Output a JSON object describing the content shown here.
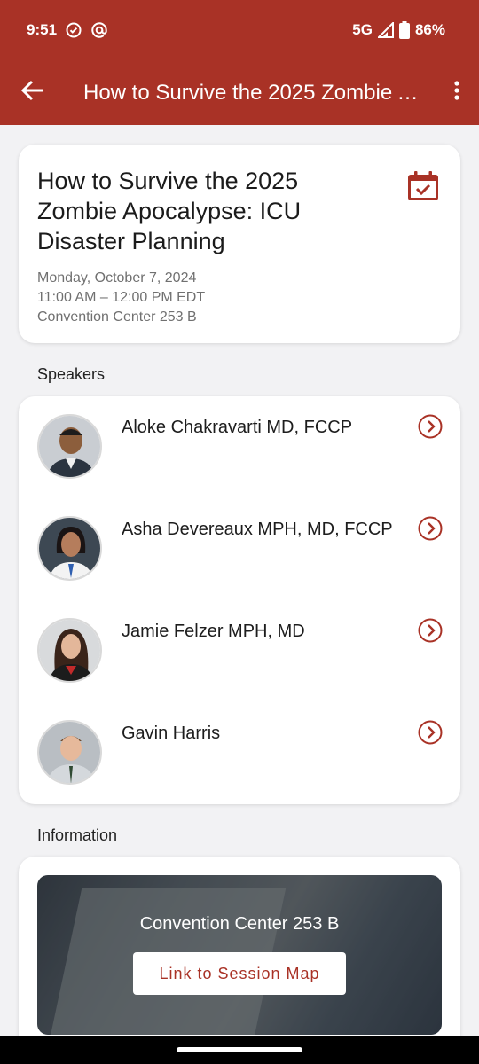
{
  "status_bar": {
    "time": "9:51",
    "network": "5G",
    "battery": "86%"
  },
  "toolbar": {
    "title": "How to Survive the 2025 Zombie Apocalypse: ICU Disaster Planning"
  },
  "session": {
    "title": "How to Survive the 2025 Zombie Apocalypse: ICU Disaster Planning",
    "date": "Monday, October 7, 2024",
    "time": "11:00 AM – 12:00 PM EDT",
    "location": "Convention Center 253 B"
  },
  "speakers_label": "Speakers",
  "speakers": [
    {
      "name": "Aloke Chakravarti MD, FCCP"
    },
    {
      "name": "Asha Devereaux MPH, MD, FCCP"
    },
    {
      "name": "Jamie Felzer MPH, MD"
    },
    {
      "name": "Gavin Harris"
    }
  ],
  "information_label": "Information",
  "information": {
    "location": "Convention Center 253 B",
    "map_link": "Link to Session Map"
  },
  "colors": {
    "brand": "#a93226",
    "background": "#f2f2f4"
  }
}
